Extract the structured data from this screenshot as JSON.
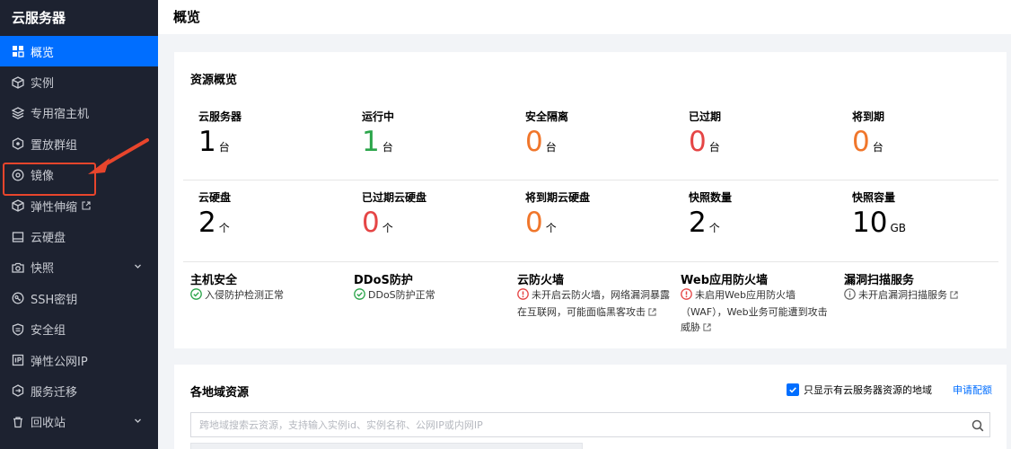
{
  "sidebar": {
    "brand": "云服务器",
    "items": [
      {
        "label": "概览",
        "icon": "grid-icon",
        "active": true
      },
      {
        "label": "实例",
        "icon": "cube-icon"
      },
      {
        "label": "专用宿主机",
        "icon": "layers-icon"
      },
      {
        "label": "置放群组",
        "icon": "hexagon-group-icon"
      },
      {
        "label": "镜像",
        "icon": "disc-icon"
      },
      {
        "label": "弹性伸缩",
        "icon": "cube-icon",
        "external": true
      },
      {
        "label": "云硬盘",
        "icon": "disk-icon"
      },
      {
        "label": "快照",
        "icon": "camera-icon",
        "expandable": true
      },
      {
        "label": "SSH密钥",
        "icon": "key-icon"
      },
      {
        "label": "安全组",
        "icon": "shield-icon"
      },
      {
        "label": "弹性公网IP",
        "icon": "ip-icon"
      },
      {
        "label": "服务迁移",
        "icon": "migrate-icon"
      },
      {
        "label": "回收站",
        "icon": "trash-icon",
        "expandable": true
      }
    ]
  },
  "header": {
    "title": "概览"
  },
  "overview": {
    "title": "资源概览",
    "row1": [
      {
        "label": "云服务器",
        "value": "1",
        "unit": "台",
        "color": "#000000"
      },
      {
        "label": "运行中",
        "value": "1",
        "unit": "台",
        "color": "#2ba54a"
      },
      {
        "label": "安全隔离",
        "value": "0",
        "unit": "台",
        "color": "#f0762b"
      },
      {
        "label": "已过期",
        "value": "0",
        "unit": "台",
        "color": "#e54545"
      },
      {
        "label": "将到期",
        "value": "0",
        "unit": "台",
        "color": "#f0762b"
      }
    ],
    "row2": [
      {
        "label": "云硬盘",
        "value": "2",
        "unit": "个",
        "color": "#000000"
      },
      {
        "label": "已过期云硬盘",
        "value": "0",
        "unit": "个",
        "color": "#e54545"
      },
      {
        "label": "将到期云硬盘",
        "value": "0",
        "unit": "个",
        "color": "#f0762b"
      },
      {
        "label": "快照数量",
        "value": "2",
        "unit": "个",
        "color": "#000000"
      },
      {
        "label": "快照容量",
        "value": "10",
        "unit": "GB",
        "color": "#000000"
      }
    ],
    "security": [
      {
        "title": "主机安全",
        "status": "ok",
        "text": "入侵防护检测正常"
      },
      {
        "title": "DDoS防护",
        "status": "ok",
        "text": "DDoS防护正常"
      },
      {
        "title": "云防火墙",
        "status": "error",
        "text": "未开启云防火墙，网络漏洞暴露在互联网，可能面临黑客攻击",
        "external": true
      },
      {
        "title": "Web应用防火墙",
        "status": "error",
        "text": "未启用Web应用防火墙（WAF），Web业务可能遭到攻击威胁",
        "external": true
      },
      {
        "title": "漏洞扫描服务",
        "status": "info",
        "text": "未开启漏洞扫描服务",
        "external": true
      }
    ]
  },
  "region": {
    "title": "各地域资源",
    "checkbox_label": "只显示有云服务器资源的地域",
    "checkbox_checked": true,
    "apply_link": "申请配额",
    "search_placeholder": "跨地域搜索云资源，支持输入实例id、实例名称、公网IP或内网IP"
  },
  "colors": {
    "accent": "#006eff",
    "sidebar_bg": "#1d2230",
    "annotation": "#e8452c"
  }
}
